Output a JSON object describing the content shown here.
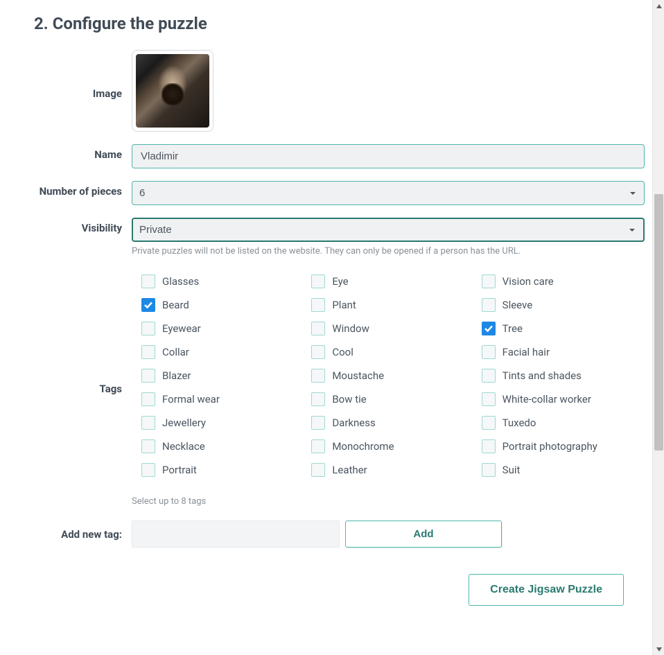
{
  "section_title": "2. Configure the puzzle",
  "labels": {
    "image": "Image",
    "name": "Name",
    "pieces": "Number of pieces",
    "visibility": "Visibility",
    "tags": "Tags",
    "add_new_tag": "Add new tag:"
  },
  "name_value": "Vladimir",
  "pieces_value": "6",
  "visibility_value": "Private",
  "visibility_helper": "Private puzzles will not be listed on the website. They can only be opened if a person has the URL.",
  "tags": [
    {
      "label": "Glasses",
      "checked": false
    },
    {
      "label": "Eye",
      "checked": false
    },
    {
      "label": "Vision care",
      "checked": false
    },
    {
      "label": "Beard",
      "checked": true
    },
    {
      "label": "Plant",
      "checked": false
    },
    {
      "label": "Sleeve",
      "checked": false
    },
    {
      "label": "Eyewear",
      "checked": false
    },
    {
      "label": "Window",
      "checked": false
    },
    {
      "label": "Tree",
      "checked": true
    },
    {
      "label": "Collar",
      "checked": false
    },
    {
      "label": "Cool",
      "checked": false
    },
    {
      "label": "Facial hair",
      "checked": false
    },
    {
      "label": "Blazer",
      "checked": false
    },
    {
      "label": "Moustache",
      "checked": false
    },
    {
      "label": "Tints and shades",
      "checked": false
    },
    {
      "label": "Formal wear",
      "checked": false
    },
    {
      "label": "Bow tie",
      "checked": false
    },
    {
      "label": "White-collar worker",
      "checked": false
    },
    {
      "label": "Jewellery",
      "checked": false
    },
    {
      "label": "Darkness",
      "checked": false
    },
    {
      "label": "Tuxedo",
      "checked": false
    },
    {
      "label": "Necklace",
      "checked": false
    },
    {
      "label": "Monochrome",
      "checked": false
    },
    {
      "label": "Portrait photography",
      "checked": false
    },
    {
      "label": "Portrait",
      "checked": false
    },
    {
      "label": "Leather",
      "checked": false
    },
    {
      "label": "Suit",
      "checked": false
    }
  ],
  "tags_helper": "Select up to 8 tags",
  "add_tag_value": "",
  "buttons": {
    "add": "Add",
    "create": "Create Jigsaw Puzzle"
  }
}
